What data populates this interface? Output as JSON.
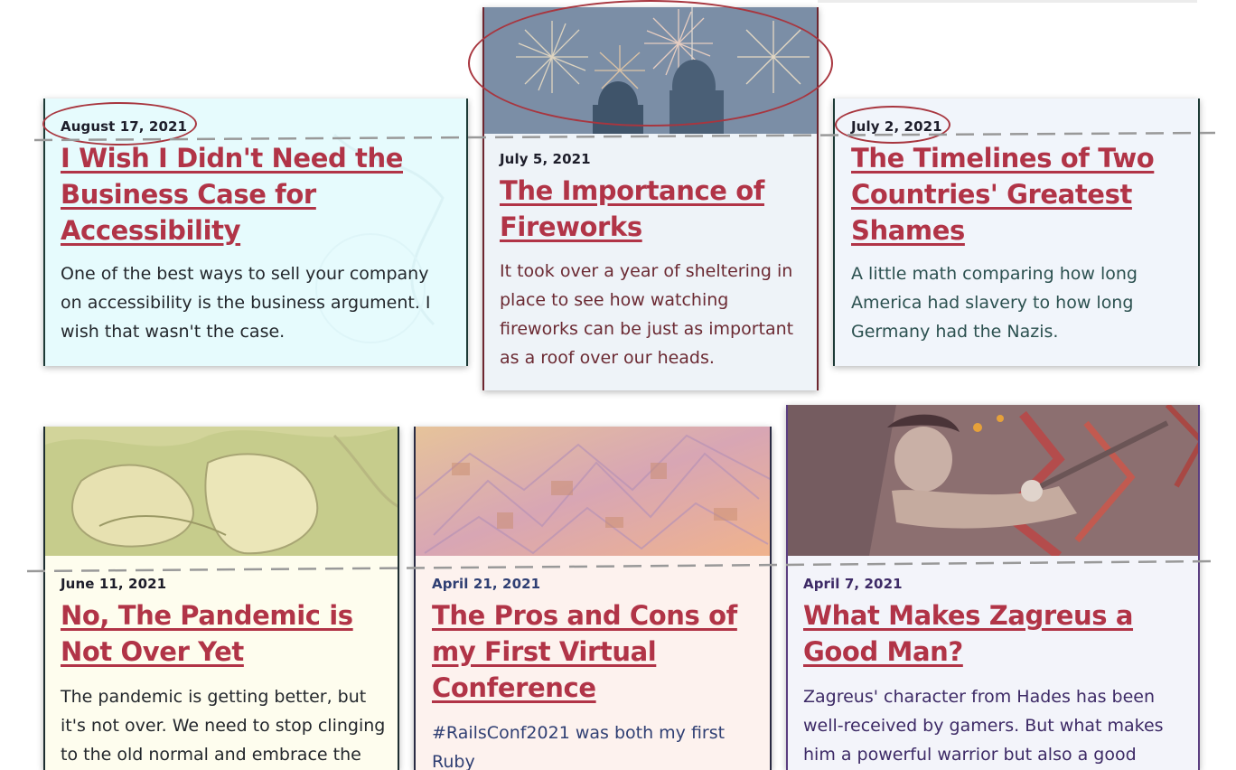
{
  "posts": [
    {
      "date": "August 17, 2021",
      "title": "I Wish I Didn't Need the Business Case for Accessibility",
      "excerpt": "One of the best ways to sell your company on accessibility is the business argument. I wish that wasn't the case."
    },
    {
      "date": "July 5, 2021",
      "title": "The Importance of Fireworks",
      "excerpt": "It took over a year of sheltering in place to see how watching fireworks can be just as important as a roof over our heads.",
      "image": "fireworks-image"
    },
    {
      "date": "July 2, 2021",
      "title": "The Timelines of Two Countries' Greatest Shames",
      "excerpt": "A little math comparing how long America had slavery to how long Germany had the Nazis."
    },
    {
      "date": "June 11, 2021",
      "title": "No, The Pandemic is Not Over Yet",
      "excerpt": "The pandemic is getting better, but it's not over. We need to stop clinging to the old normal and embrace the new",
      "image": "masked-faces-image"
    },
    {
      "date": "April 21, 2021",
      "title": "The Pros and Cons of my First Virtual Conference",
      "excerpt": "#RailsConf2021 was both my first Ruby",
      "image": "colorful-city-image"
    },
    {
      "date": "April 7, 2021",
      "title": "What Makes Zagreus a Good Man?",
      "excerpt": "Zagreus' character from Hades has been well-received by gamers. But what makes him a powerful warrior but also a good man?",
      "image": "zagreus-image"
    }
  ],
  "colors": {
    "title": "#b13447",
    "annotation_circle": "#a8363f",
    "dashed_line": "#9a9a9a"
  }
}
